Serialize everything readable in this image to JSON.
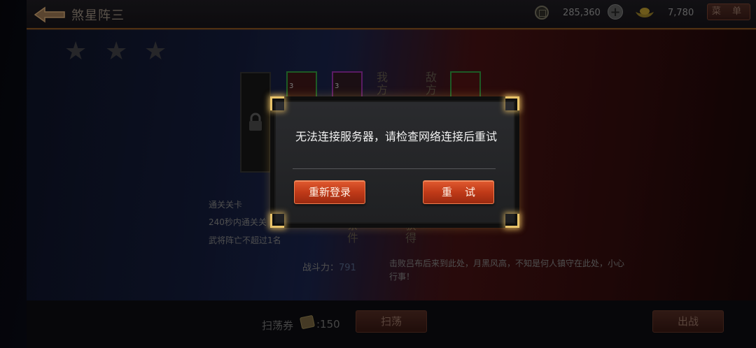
{
  "header": {
    "title": "煞星阵三",
    "coins": "285,360",
    "ingots": "7,780",
    "menu_label": "菜 单"
  },
  "stage": {
    "stars": [
      "★",
      "★",
      "★"
    ],
    "our_unit_label": "我方武",
    "enemy_unit_label": "敌方武",
    "unit_levels": [
      "3",
      "3"
    ],
    "conditions_title": "通关关卡",
    "conditions": [
      "240秒内通关关",
      "武将阵亡不超过1名"
    ],
    "condition_tab": "条件",
    "reward_tab": "获得",
    "fight_power_label": "战斗力：",
    "fight_power_value": "791",
    "story": "击败吕布后来到此处，月黑风高，不知是何人镇守在此处，小心行事！"
  },
  "bottom": {
    "sweep_ticket_label": "扫荡券",
    "sweep_ticket_count": ":150",
    "sweep_button": "扫荡",
    "battle_button": "出战"
  },
  "dialog": {
    "message": "无法连接服务器，请检查网络连接后重试",
    "relogin_button": "重新登录",
    "retry_button": "重试"
  },
  "colors": {
    "dialog_corner": "#e8c36a",
    "button_red": "#c03a18"
  }
}
